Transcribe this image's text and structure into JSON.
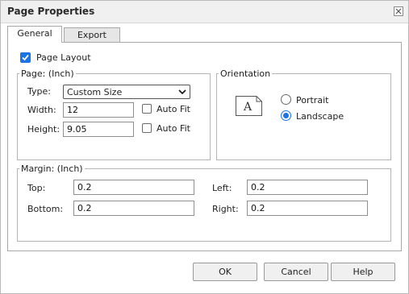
{
  "window": {
    "title": "Page Properties"
  },
  "tabs": [
    {
      "label": "General",
      "active": true
    },
    {
      "label": "Export",
      "active": false
    }
  ],
  "page_layout": {
    "label": "Page Layout",
    "checked": true
  },
  "page_group": {
    "legend": "Page: (Inch)",
    "type_label": "Type:",
    "type_value": "Custom Size",
    "width_label": "Width:",
    "width_value": "12",
    "height_label": "Height:",
    "height_value": "9.05",
    "autofit_label": "Auto Fit"
  },
  "orientation_group": {
    "legend": "Orientation",
    "icon_letter": "A",
    "options": [
      {
        "label": "Portrait",
        "selected": false
      },
      {
        "label": "Landscape",
        "selected": true
      }
    ]
  },
  "margin_group": {
    "legend": "Margin: (Inch)",
    "top_label": "Top:",
    "top_value": "0.2",
    "bottom_label": "Bottom:",
    "bottom_value": "0.2",
    "left_label": "Left:",
    "left_value": "0.2",
    "right_label": "Right:",
    "right_value": "0.2"
  },
  "buttons": {
    "ok": "OK",
    "cancel": "Cancel",
    "help": "Help"
  },
  "colors": {
    "accent": "#1a73e8"
  }
}
